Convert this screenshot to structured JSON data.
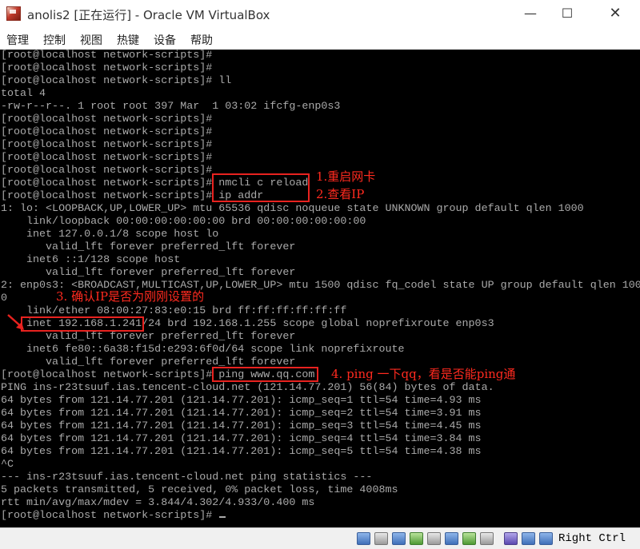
{
  "window": {
    "title": "anolis2 [正在运行] - Oracle VM VirtualBox",
    "minimize_glyph": "—",
    "maximize_glyph": "☐",
    "close_glyph": "✕"
  },
  "menu": [
    "管理",
    "控制",
    "视图",
    "热键",
    "设备",
    "帮助"
  ],
  "terminal": {
    "lines": [
      "[root@localhost network-scripts]#",
      "[root@localhost network-scripts]#",
      "[root@localhost network-scripts]# ll",
      "total 4",
      "-rw-r--r--. 1 root root 397 Mar  1 03:02 ifcfg-enp0s3",
      "[root@localhost network-scripts]#",
      "[root@localhost network-scripts]#",
      "[root@localhost network-scripts]#",
      "[root@localhost network-scripts]#",
      "[root@localhost network-scripts]#",
      "[root@localhost network-scripts]# nmcli c reload",
      "[root@localhost network-scripts]# ip addr",
      "1: lo: <LOOPBACK,UP,LOWER_UP> mtu 65536 qdisc noqueue state UNKNOWN group default qlen 1000",
      "    link/loopback 00:00:00:00:00:00 brd 00:00:00:00:00:00",
      "    inet 127.0.0.1/8 scope host lo",
      "       valid_lft forever preferred_lft forever",
      "    inet6 ::1/128 scope host",
      "       valid_lft forever preferred_lft forever",
      "2: enp0s3: <BROADCAST,MULTICAST,UP,LOWER_UP> mtu 1500 qdisc fq_codel state UP group default qlen 100",
      "0",
      "    link/ether 08:00:27:83:e0:15 brd ff:ff:ff:ff:ff:ff",
      "    inet 192.168.1.241/24 brd 192.168.1.255 scope global noprefixroute enp0s3",
      "       valid_lft forever preferred_lft forever",
      "    inet6 fe80::6a38:f15d:e293:6f0d/64 scope link noprefixroute",
      "       valid_lft forever preferred_lft forever",
      "[root@localhost network-scripts]# ping www.qq.com",
      "PING ins-r23tsuuf.ias.tencent-cloud.net (121.14.77.201) 56(84) bytes of data.",
      "64 bytes from 121.14.77.201 (121.14.77.201): icmp_seq=1 ttl=54 time=4.93 ms",
      "64 bytes from 121.14.77.201 (121.14.77.201): icmp_seq=2 ttl=54 time=3.91 ms",
      "64 bytes from 121.14.77.201 (121.14.77.201): icmp_seq=3 ttl=54 time=4.45 ms",
      "64 bytes from 121.14.77.201 (121.14.77.201): icmp_seq=4 ttl=54 time=3.84 ms",
      "64 bytes from 121.14.77.201 (121.14.77.201): icmp_seq=5 ttl=54 time=4.38 ms",
      "^C",
      "--- ins-r23tsuuf.ias.tencent-cloud.net ping statistics ---",
      "5 packets transmitted, 5 received, 0% packet loss, time 4008ms",
      "rtt min/avg/max/mdev = 3.844/4.302/4.933/0.400 ms",
      "[root@localhost network-scripts]# "
    ]
  },
  "annotations": {
    "a1": "1.重启网卡",
    "a2": "2.查看IP",
    "a3": "3. 确认IP是否为刚刚设置的",
    "a4": "4. ping 一下qq，看是否能ping通"
  },
  "statusbar": {
    "icons": [
      "optical-drive-icon",
      "usb-icon",
      "network-icon",
      "shared-folder-icon",
      "display-icon",
      "video-capture-icon",
      "hard-disk-icon",
      "audio-icon",
      "vt-x-icon",
      "mouse-integration-icon",
      "keyboard-capture-icon"
    ],
    "host_key": "Right Ctrl"
  },
  "colors": {
    "terminal_bg": "#000000",
    "terminal_fg": "#aaaaaa",
    "annotation_red": "#e8221f"
  }
}
